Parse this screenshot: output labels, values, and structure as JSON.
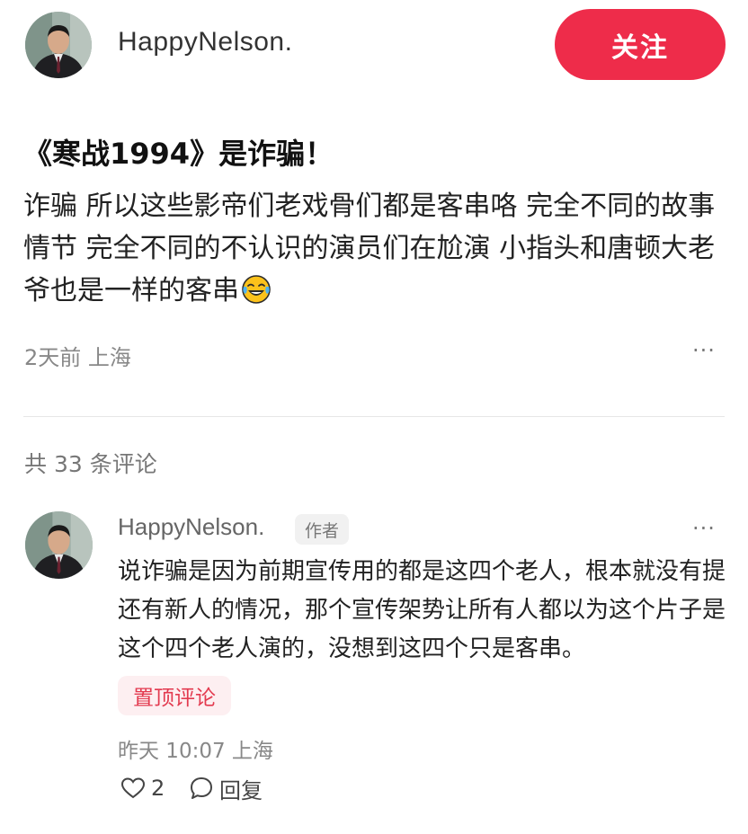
{
  "post": {
    "username": "HappyNelson.",
    "follow_label": "关注",
    "title": "《寒战1994》是诈骗！",
    "body": "诈骗 所以这些影帝们老戏骨们都是客串咯 完全不同的故事情节 完全不同的不认识的演员们在尬演 小指头和唐顿大老爷也是一样的客串",
    "emoji": "laughing-tears-emoji",
    "meta": "2天前 上海",
    "more": "···"
  },
  "comments": {
    "count_text": "共 33 条评论",
    "items": [
      {
        "username": "HappyNelson.",
        "badge": "作者",
        "text": "说诈骗是因为前期宣传用的都是这四个老人，根本就没有提还有新人的情况，那个宣传架势让所有人都以为这个片子是这个四个老人演的，没想到这四个只是客串。",
        "pin_label": "置顶评论",
        "meta": "昨天 10:07 上海",
        "likes": "2",
        "reply_label": "回复",
        "more": "···"
      }
    ]
  },
  "colors": {
    "follow_button": "#ee2c4a",
    "pin_badge_text": "#e33a4f",
    "pin_badge_bg": "#fdeff1"
  }
}
